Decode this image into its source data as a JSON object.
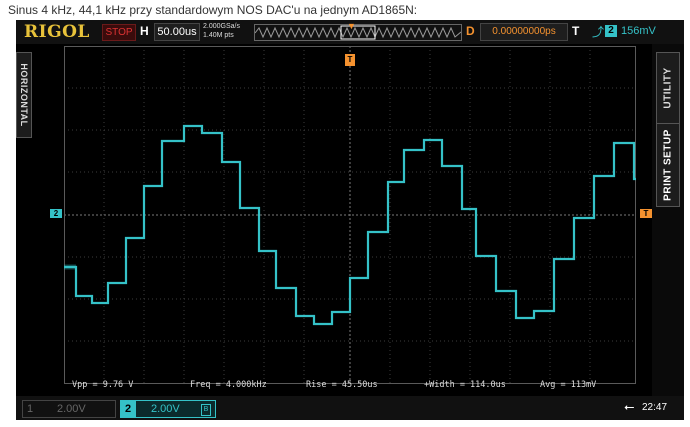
{
  "caption": "Sinus 4 kHz, 44,1 kHz przy standardowym NOS DAC'u na jednym AD1865N:",
  "topbar": {
    "brand": "RIGOL",
    "run_state": "STOP",
    "horizontal_label": "H",
    "timebase": "50.00us",
    "sample_rate": "2.000GSa/s",
    "memory_depth": "1.40M pts",
    "delay_label": "D",
    "delay_value": "0.00000000ps",
    "trigger_label": "T",
    "trigger_channel": "2",
    "trigger_level": "156mV"
  },
  "side_tabs": {
    "left": "HORIZONTAL",
    "utility": "UTILITY",
    "print_setup": "PRINT SETUP"
  },
  "markers": {
    "channel2_ground": "2",
    "trigger_level_marker": "T",
    "trigger_position_marker": "T"
  },
  "measurements": [
    {
      "label": "Vpp = 9.76 V"
    },
    {
      "label": "Freq = 4.000kHz"
    },
    {
      "label": "Rise = 45.50us"
    },
    {
      "label": "+Width = 114.0us"
    },
    {
      "label": "Avg = 113mV"
    }
  ],
  "channels": [
    {
      "number": "1",
      "scale": "2.00V",
      "active": false
    },
    {
      "number": "2",
      "scale": "2.00V",
      "active": true,
      "bw_icon": "B"
    }
  ],
  "status": {
    "usb_icon": "usb-icon",
    "time": "22:47"
  },
  "colors": {
    "channel2": "#35c2c8",
    "trigger": "#f5922f",
    "brand": "#e8c23a",
    "stop": "#dd3333"
  }
}
